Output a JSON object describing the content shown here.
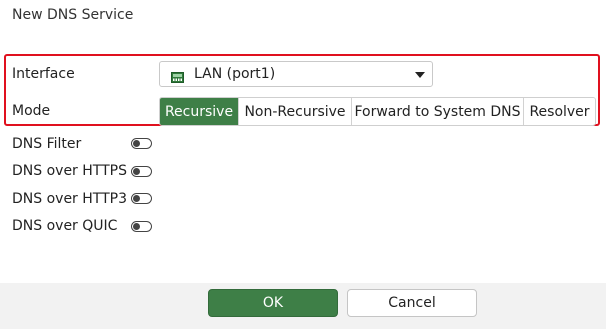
{
  "dialog": {
    "title": "New DNS Service"
  },
  "form": {
    "interface": {
      "label": "Interface",
      "value": "LAN (port1)",
      "icon": "network-port-icon"
    },
    "mode": {
      "label": "Mode",
      "options": [
        "Recursive",
        "Non-Recursive",
        "Forward to System DNS",
        "Resolver"
      ],
      "selected": "Recursive"
    },
    "toggles": [
      {
        "label": "DNS Filter",
        "enabled": false
      },
      {
        "label": "DNS over HTTPS",
        "enabled": false
      },
      {
        "label": "DNS over HTTP3",
        "enabled": false
      },
      {
        "label": "DNS over QUIC",
        "enabled": false
      }
    ]
  },
  "footer": {
    "ok_label": "OK",
    "cancel_label": "Cancel"
  },
  "colors": {
    "accent_green": "#3e7f47",
    "highlight_red": "#e0101e"
  }
}
